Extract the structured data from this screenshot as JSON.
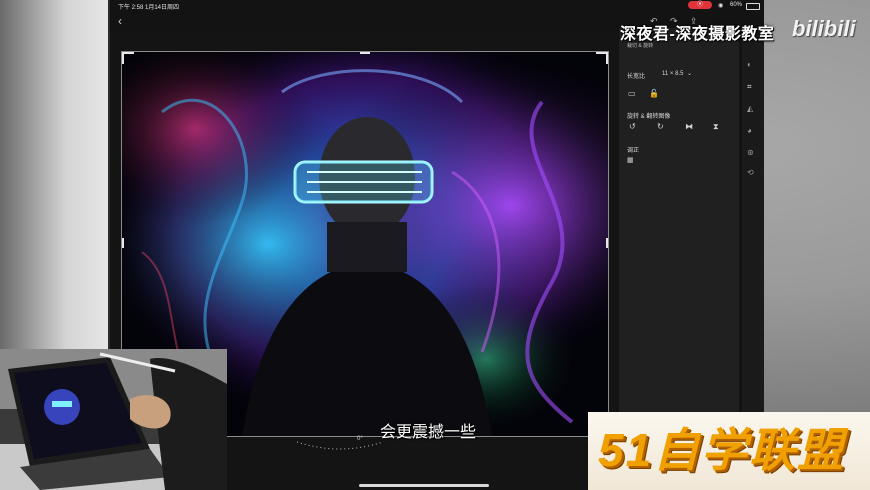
{
  "status_bar": {
    "time_date": "下午 2:58  1月14日周四",
    "record_badge": "",
    "battery": "60%"
  },
  "toolbar": {
    "back_icon": "chevron-left-icon"
  },
  "panel": {
    "header": "裁切 & 旋转",
    "aspect_label": "长宽比",
    "aspect_value": "11 × 8.5",
    "rotate_label": "旋转 & 翻转图像",
    "straighten_label": "调正"
  },
  "rotation": {
    "value": "0°"
  },
  "overlay": {
    "channel_title": "深夜君-深夜摄影教室",
    "bilibili_logo": "bilibili",
    "subtitle": "会更震撼一些",
    "site_logo": "51自学联盟"
  },
  "colors": {
    "accent_red": "#e0333a",
    "panel_bg": "#202020",
    "logo_orange": "#f0a000"
  }
}
